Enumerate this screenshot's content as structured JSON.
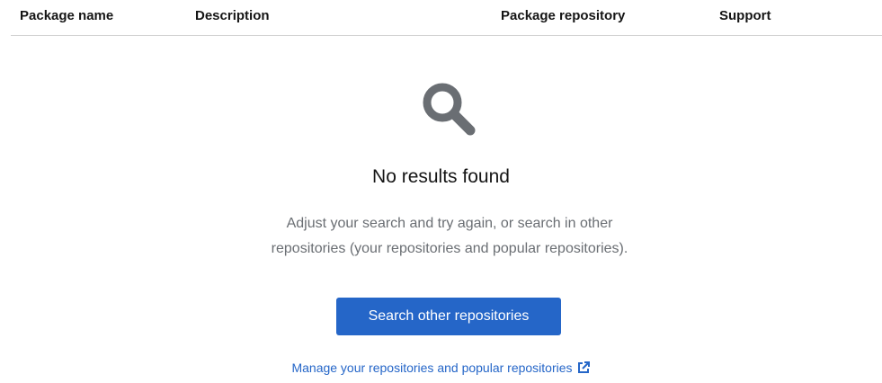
{
  "table": {
    "columns": {
      "package_name": "Package name",
      "description": "Description",
      "package_repository": "Package repository",
      "support": "Support"
    }
  },
  "empty_state": {
    "icon": "search-icon",
    "title": "No results found",
    "body_line_1": "Adjust your search and try again, or search in other",
    "body_line_2": "repositories (your repositories and popular repositories).",
    "primary_button_label": "Search other repositories",
    "link_label": "Manage your repositories and popular repositories",
    "link_icon": "external-link-icon"
  },
  "colors": {
    "accent": "#2566c8",
    "icon_gray": "#6a6e73",
    "divider": "#d2d2d2"
  }
}
